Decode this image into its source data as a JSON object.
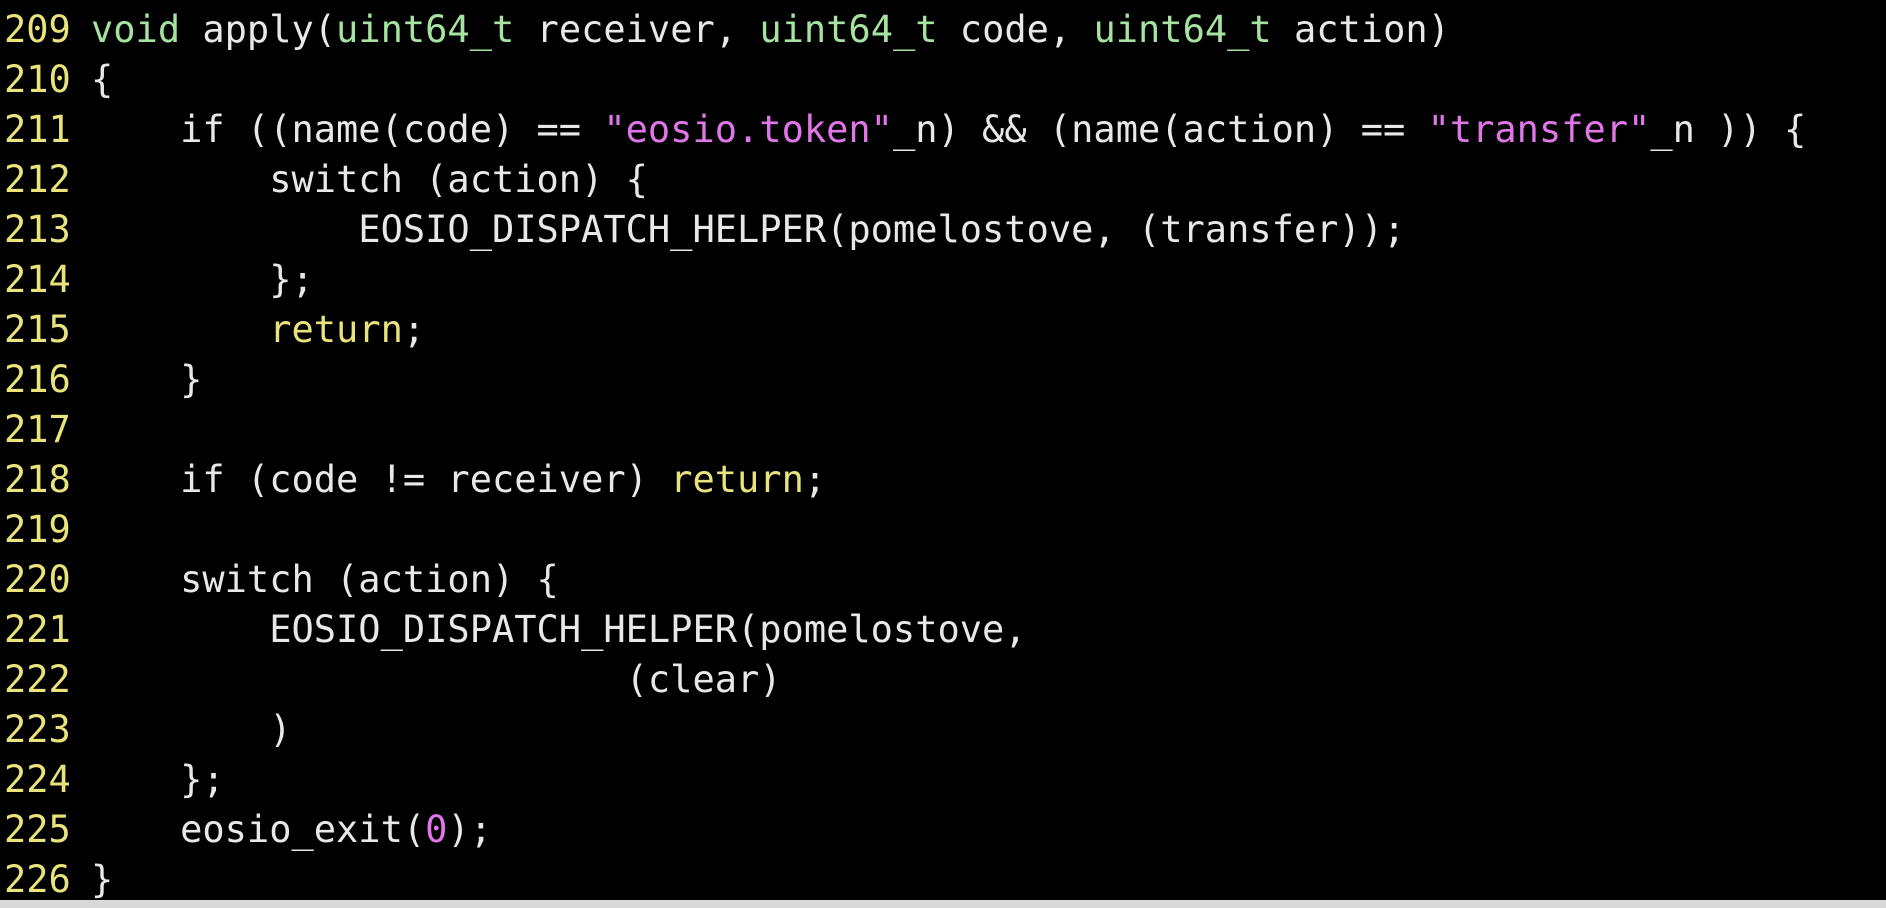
{
  "editor": {
    "lines": [
      {
        "num": "209",
        "tokens": [
          {
            "t": "void apply(",
            "c": "tp0"
          },
          {
            "t": "uint64_t",
            "c": "tp"
          },
          {
            "t": " receiver, ",
            "c": "pl"
          },
          {
            "t": "uint64_t",
            "c": "tp"
          },
          {
            "t": " code, ",
            "c": "pl"
          },
          {
            "t": "uint64_t",
            "c": "tp"
          },
          {
            "t": " action)",
            "c": "pl"
          }
        ]
      },
      {
        "num": "210",
        "tokens": [
          {
            "t": "{",
            "c": "pl"
          }
        ]
      },
      {
        "num": "211",
        "tokens": [
          {
            "t": "    if ((name(code) == ",
            "c": "pl"
          },
          {
            "t": "\"eosio.token\"",
            "c": "st"
          },
          {
            "t": "_n) && (name(action) == ",
            "c": "pl"
          },
          {
            "t": "\"transfer\"",
            "c": "st"
          },
          {
            "t": "_n )) {",
            "c": "pl"
          }
        ]
      },
      {
        "num": "212",
        "tokens": [
          {
            "t": "        switch (action) {",
            "c": "pl"
          }
        ]
      },
      {
        "num": "213",
        "tokens": [
          {
            "t": "            EOSIO_DISPATCH_HELPER(pomelostove, (transfer));",
            "c": "pl"
          }
        ]
      },
      {
        "num": "214",
        "tokens": [
          {
            "t": "        };",
            "c": "pl"
          }
        ]
      },
      {
        "num": "215",
        "tokens": [
          {
            "t": "        ",
            "c": "pl"
          },
          {
            "t": "return",
            "c": "kw"
          },
          {
            "t": ";",
            "c": "pl"
          }
        ]
      },
      {
        "num": "216",
        "tokens": [
          {
            "t": "    }",
            "c": "pl"
          }
        ]
      },
      {
        "num": "217",
        "tokens": []
      },
      {
        "num": "218",
        "tokens": [
          {
            "t": "    if (code != receiver) ",
            "c": "pl"
          },
          {
            "t": "return",
            "c": "kw"
          },
          {
            "t": ";",
            "c": "pl"
          }
        ]
      },
      {
        "num": "219",
        "tokens": []
      },
      {
        "num": "220",
        "tokens": [
          {
            "t": "    switch (action) {",
            "c": "pl"
          }
        ]
      },
      {
        "num": "221",
        "tokens": [
          {
            "t": "        EOSIO_DISPATCH_HELPER(pomelostove,",
            "c": "pl"
          }
        ]
      },
      {
        "num": "222",
        "tokens": [
          {
            "t": "                        (clear)",
            "c": "pl"
          }
        ]
      },
      {
        "num": "223",
        "tokens": [
          {
            "t": "        )",
            "c": "pl"
          }
        ]
      },
      {
        "num": "224",
        "tokens": [
          {
            "t": "    };",
            "c": "pl"
          }
        ]
      },
      {
        "num": "225",
        "tokens": [
          {
            "t": "    eosio_exit(",
            "c": "pl"
          },
          {
            "t": "0",
            "c": "st"
          },
          {
            "t": ");",
            "c": "pl"
          }
        ]
      },
      {
        "num": "226",
        "tokens": [
          {
            "t": "}",
            "c": "pl"
          }
        ]
      }
    ]
  },
  "colors": {
    "background": "#000000",
    "line_number": "#e9e37b",
    "keyword": "#e9e37b",
    "type": "#a6e3a1",
    "string": "#e076e8",
    "text": "#e8e8e8"
  }
}
